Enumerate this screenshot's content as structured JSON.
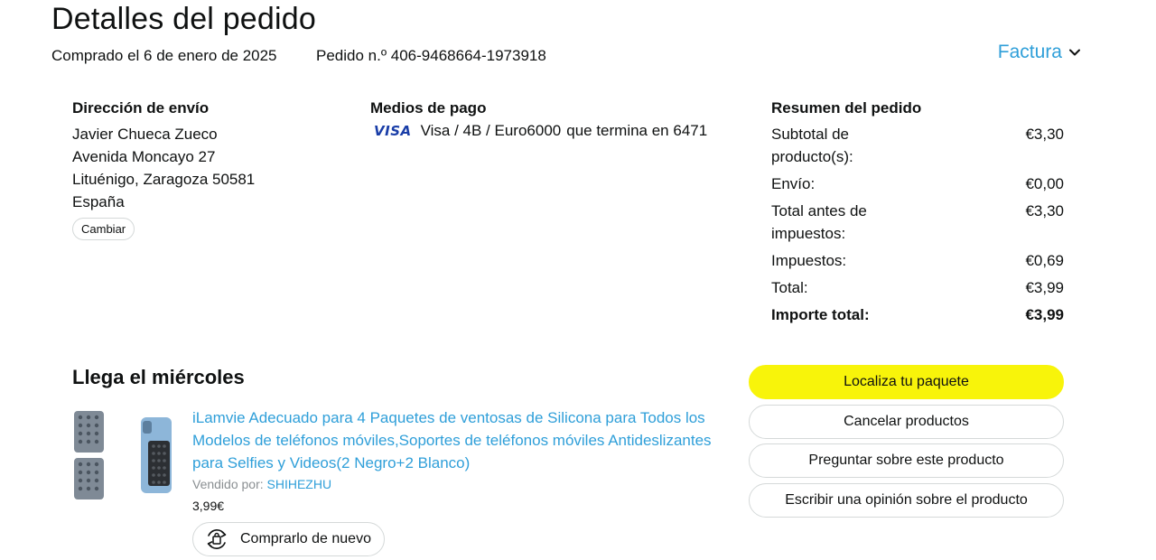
{
  "header": {
    "title": "Detalles del pedido",
    "purchased": "Comprado el 6 de enero de 2025",
    "order_number": "Pedido n.º 406-9468664-1973918",
    "invoice_label": "Factura",
    "invoice_icon": "chevron-down-icon"
  },
  "shipping": {
    "title": "Dirección de envío",
    "name": "Javier Chueca Zueco",
    "street": "Avenida Moncayo 27",
    "city": "Lituénigo, Zaragoza 50581",
    "country": "España",
    "change_label": "Cambiar"
  },
  "payment": {
    "title": "Medios de pago",
    "brand": "VISA",
    "card": "Visa / 4B / Euro6000",
    "ending": "que termina en 6471"
  },
  "summary": {
    "title": "Resumen del pedido",
    "rows": [
      {
        "label": "Subtotal de producto(s):",
        "value": "€3,30"
      },
      {
        "label": "Envío:",
        "value": "€0,00"
      },
      {
        "label": "Total antes de impuestos:",
        "value": "€3,30"
      },
      {
        "label": "Impuestos:",
        "value": "€0,69"
      },
      {
        "label": "Total:",
        "value": "€3,99"
      }
    ],
    "grand_total_label": "Importe total:",
    "grand_total_value": "€3,99"
  },
  "shipment": {
    "arrival": "Llega el miércoles",
    "product": {
      "title": "iLamvie Adecuado para 4 Paquetes de ventosas de Silicona para Todos los Modelos de teléfonos móviles,Soportes de teléfonos móviles Antideslizantes para Selfies y Videos(2 Negro+2 Blanco)",
      "sold_by_label": "Vendido por:",
      "seller": "SHIHEZHU",
      "price": "3,99€",
      "buy_again_label": "Comprarlo de nuevo",
      "buy_again_icon": "reorder-icon"
    },
    "actions": [
      {
        "label": "Localiza tu paquete"
      },
      {
        "label": "Cancelar productos"
      },
      {
        "label": "Preguntar sobre este producto"
      },
      {
        "label": "Escribir una opinión sobre el producto"
      }
    ]
  },
  "colors": {
    "link": "#2f9fd9",
    "primary_button": "#f8f40a",
    "visa_blue": "#1a3ea8"
  }
}
